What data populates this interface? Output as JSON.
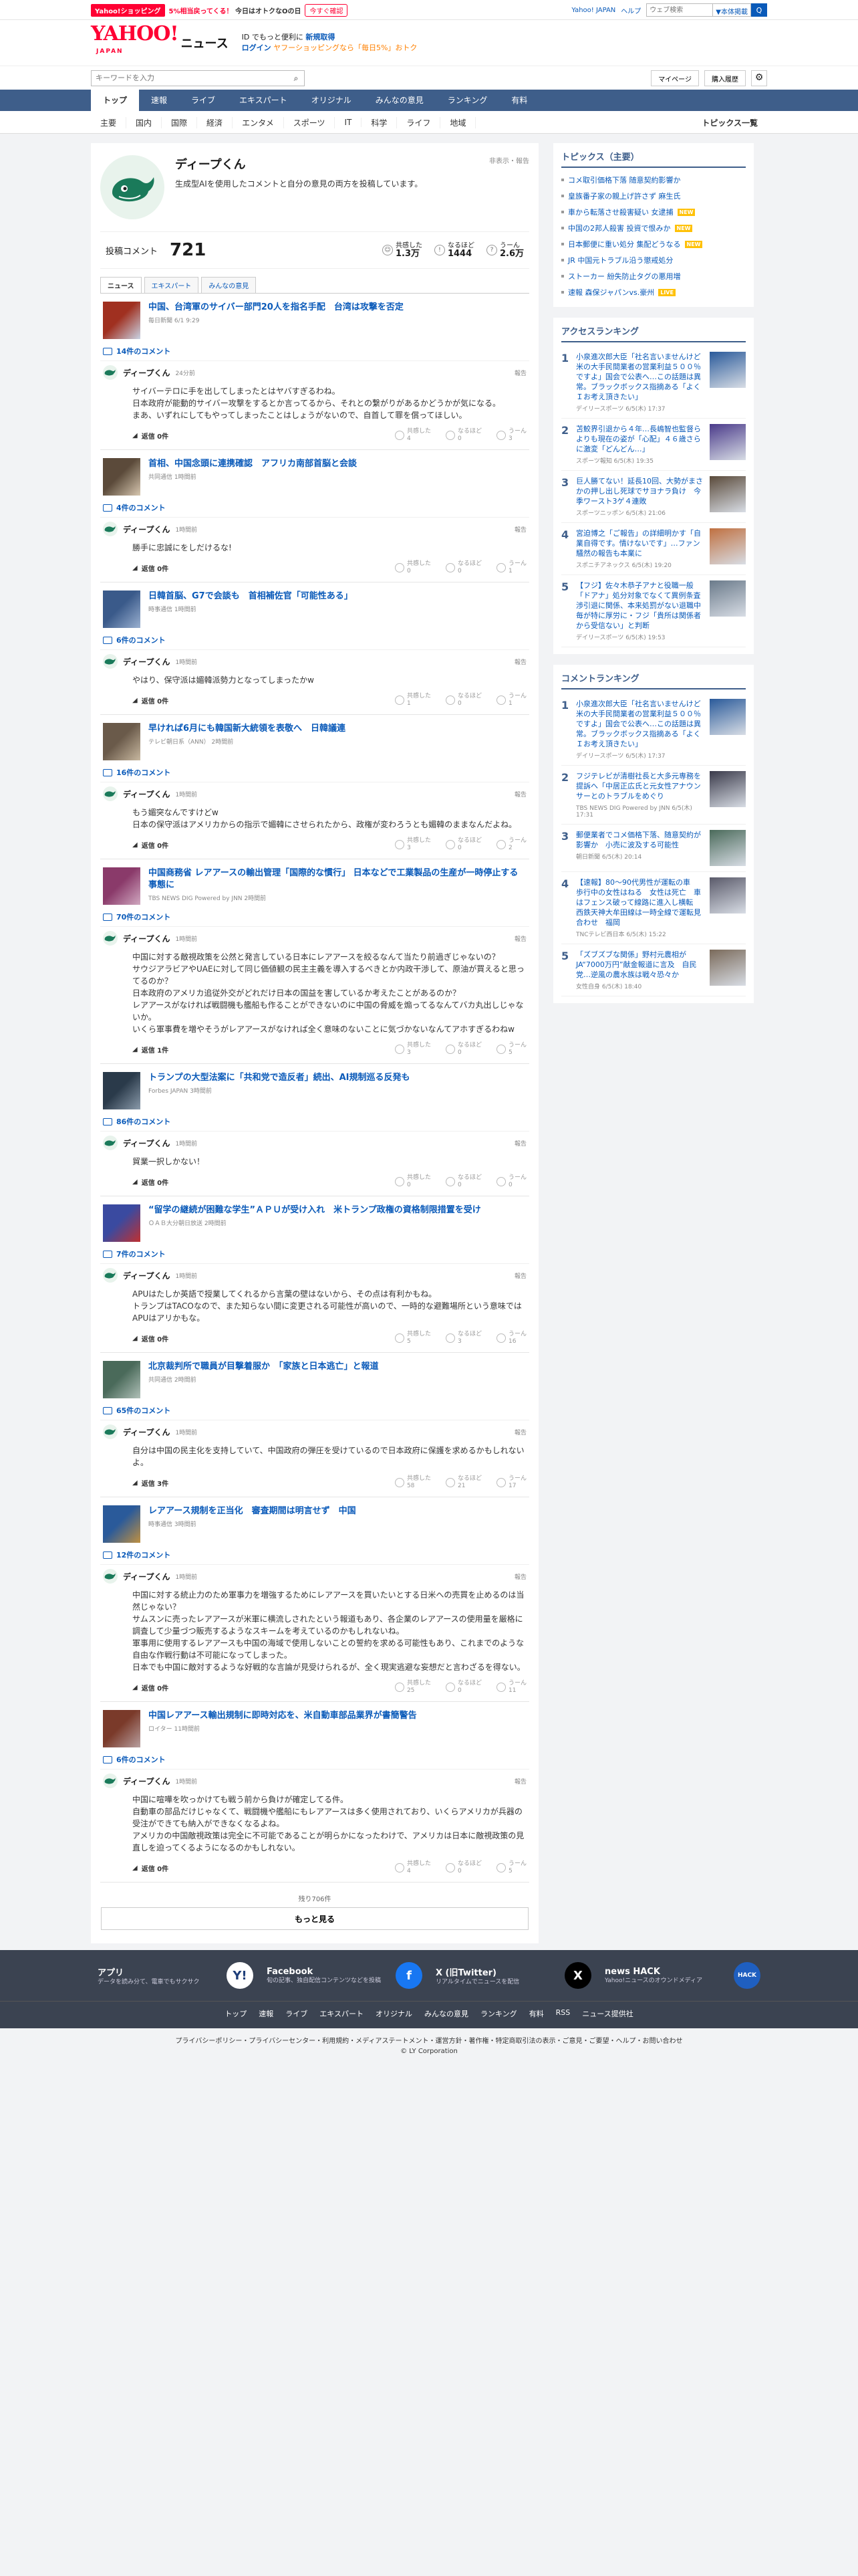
{
  "ribbon": {
    "shop": "Yahoo!ショッピング",
    "promo_a": "5%相当戻ってくる！",
    "promo_b": "今日はオトクなOの日",
    "cta": "今すぐ確認",
    "yj": "Yahoo! JAPAN",
    "help": "ヘルプ",
    "search_placeholder": "ウェブ検索",
    "category": "▼本体掲載",
    "go": "Q"
  },
  "header": {
    "logo": "YAHOO!",
    "logo_sub": "JAPAN",
    "news": "ニュース",
    "promo_line1": "ID でもっと便利に",
    "promo_link1": "新規取得",
    "promo_link2": "ログイン",
    "promo_line2": "ヤフーショッピングなら「毎日5%」おトク"
  },
  "search": {
    "placeholder": "キーワードを入力",
    "mypage": "マイページ",
    "history": "購入履歴"
  },
  "gnav": [
    "トップ",
    "速報",
    "ライブ",
    "エキスパート",
    "オリジナル",
    "みんなの意見",
    "ランキング",
    "有料"
  ],
  "catnav": [
    "主要",
    "国内",
    "国際",
    "経済",
    "エンタメ",
    "スポーツ",
    "IT",
    "科学",
    "ライフ",
    "地域"
  ],
  "catnav_topics": "トピックス一覧",
  "profile": {
    "name": "ディープくん",
    "desc": "生成型AIを使用したコメントと自分の意見の両方を投稿しています。",
    "meta": "非表示・報告",
    "stat_label": "投稿コメント",
    "stat_num": "721",
    "r1_label": "共感した",
    "r1": "1.3万",
    "r2_label": "なるほど",
    "r2": "1444",
    "r3_label": "うーん",
    "r3": "2.6万",
    "tabs": [
      "ニュース",
      "エキスパート",
      "みんなの意見"
    ]
  },
  "items": [
    {
      "title": "中国、台湾軍のサイバー部門20人を指名手配　台湾は攻撃を否定",
      "src": "毎日新聞 6/1 9:29",
      "ccount": "14件のコメント",
      "time": "24分前",
      "body": "サイバーテロに手を出してしまったとはヤバすぎるわね。\n日本政府が能動的サイバー攻撃をするとか言ってるから、それとの繋がりがあるかどうかが気になる。\nまあ、いずれにしてもやってしまったことはしょうがないので、自首して罪を償ってほしい。",
      "reply": "返信 0件",
      "r": [
        "4",
        "0",
        "3"
      ]
    },
    {
      "title": "首相、中国念頭に連携確認　アフリカ南部首脳と会談",
      "src": "共同通信 1時間前",
      "ccount": "4件のコメント",
      "time": "1時間前",
      "body": "勝手に忠誠にをしだけるな!",
      "reply": "返信 0件",
      "r": [
        "0",
        "0",
        "1"
      ]
    },
    {
      "title": "日韓首脳、G7で会談も　首相補佐官「可能性ある」",
      "src": "時事通信 1時間前",
      "ccount": "6件のコメント",
      "time": "1時間前",
      "body": "やはり、保守派は媚韓派勢力となってしまったかw",
      "reply": "返信 0件",
      "r": [
        "1",
        "0",
        "1"
      ]
    },
    {
      "title": "早ければ6月にも韓国新大統領を表敬へ　日韓議連",
      "src": "テレビ朝日系（ANN） 2時間前",
      "ccount": "16件のコメント",
      "time": "1時間前",
      "body": "もう媚突なんですけどw\n日本の保守派はアメリカからの指示で媚韓にさせられたから、政権が変わろうとも媚韓のままなんだよね。",
      "reply": "返信 0件",
      "r": [
        "3",
        "0",
        "2"
      ]
    },
    {
      "title": "中国商務省 レアアースの輸出管理「国際的な慣行」 日本などで工業製品の生産が一時停止する事態に",
      "src": "TBS NEWS DIG Powered by JNN 2時間前",
      "ccount": "70件のコメント",
      "time": "1時間前",
      "body": "中国に対する敵視政策を公然と発言している日本にレアアースを絞るなんて当たり前過ぎじゃないの？\nサウジアラビアやUAEに対して同じ価値観の民主主義を導入するべきとか内政干渉して、原油が買えると思ってるのか？\n日本政府のアメリカ追従外交がどれだけ日本の国益を害しているか考えたことがあるのか？\nレアアースがなければ戦闘機も艦船も作ることができないのに中国の脅威を煽ってるなんてバカ丸出しじゃないか。\nいくら軍事費を増やそうがレアアースがなければ全く意味のないことに気づかないなんてアホすぎるわねw",
      "reply": "返信 1件",
      "r": [
        "3",
        "0",
        "5"
      ]
    },
    {
      "title": "トランプの大型法案に「共和党で造反者」続出、AI規制巡る反発も",
      "src": "Forbes JAPAN 3時間前",
      "ccount": "86件のコメント",
      "time": "1時間前",
      "body": "貿業一択しかない！",
      "reply": "返信 0件",
      "r": [
        "0",
        "0",
        "0"
      ]
    },
    {
      "title": "“留学の継続が困難な学生”ＡＰＵが受け入れ　米トランプ政権の資格制限措置を受け",
      "src": "ＯＡＢ大分朝日放送 2時間前",
      "ccount": "7件のコメント",
      "time": "1時間前",
      "body": "APUはたしか英語で授業してくれるから言葉の壁はないから、その点は有利かもね。\nトランプはTACOなので、また知らない間に変更される可能性が高いので、一時的な避難場所という意味ではAPUはアリかもな。",
      "reply": "返信 0件",
      "r": [
        "5",
        "3",
        "16"
      ]
    },
    {
      "title": "北京裁判所で職員が目撃着服か　「家族と日本逃亡」と報道",
      "src": "共同通信 2時間前",
      "ccount": "65件のコメント",
      "time": "1時間前",
      "body": "自分は中国の民主化を支持していて、中国政府の弾圧を受けているので日本政府に保護を求めるかもしれないよ。",
      "reply": "返信 3件",
      "r": [
        "58",
        "21",
        "17"
      ]
    },
    {
      "title": "レアアース規制を正当化　審査期間は明言せず　中国",
      "src": "時事通信 3時間前",
      "ccount": "12件のコメント",
      "time": "1時間前",
      "body": "中国に対する統止力のため軍事力を増強するためにレアアースを買いたいとする日米への売買を止めるのは当然じゃない？\nサムスンに売ったレアアースが米軍に横流しされたという報道もあり、各企業のレアアースの使用量を厳格に調査して少量づつ販売するようなスキームを考えているのかもしれないね。\n軍事用に使用するレアアースも中国の海域で使用しないことの誓約を求める可能性もあり、これまでのような自由な作戦行動は不可能になってしまった。\n日本でも中国に敵対するような好戦的な言論が見受けられるが、全く現実逃避な妄想だと言わざるを得ない。",
      "reply": "返信 0件",
      "r": [
        "25",
        "0",
        "11"
      ]
    },
    {
      "title": "中国レアアース輸出規制に即時対応を、米自動車部品業界が書簡警告",
      "src": "ロイター 11時間前",
      "ccount": "6件のコメント",
      "time": "1時間前",
      "body": "中国に喧嘩を吹っかけても戦う前から負けが確定してる件。\n自動車の部品だけじゃなくて、戦闘機や艦船にもレアアースは多く使用されており、いくらアメリカが兵器の受注ができても納入ができなくなるよね。\nアメリカの中国敵視政策は完全に不可能であることが明らかになったわけで、アメリカは日本に敵視政策の見直しを迫ってくるようになるのかもしれない。",
      "reply": "返信 0件",
      "r": [
        "4",
        "0",
        "5"
      ]
    }
  ],
  "remaining": "残り706件",
  "more": "もっと見る",
  "reactions": [
    "共感した",
    "なるほど",
    "うーん"
  ],
  "report": "報告",
  "right": {
    "topics_title": "トピックス（主要）",
    "topics": [
      {
        "t": "コメ取引価格下落 随意契約影響か",
        "b": ""
      },
      {
        "t": "皇族番子家の親上げ許さず 麻生氏",
        "b": ""
      },
      {
        "t": "車から転落させ殺害疑い 女逮捕",
        "b": "NEW"
      },
      {
        "t": "中国の2邦人殺害 投資で恨みか",
        "b": "NEW"
      },
      {
        "t": "日本郵便に重い処分 集配どうなる",
        "b": "NEW"
      },
      {
        "t": "JR 中国元トラブル沿う懲戒処分",
        "b": ""
      },
      {
        "t": "ストーカー 紛失防止タグの悪用増",
        "b": ""
      },
      {
        "t": "速報 森保ジャパンvs.豪州",
        "b": "LIVE"
      }
    ],
    "access_title": "アクセスランキング",
    "access": [
      {
        "n": "1",
        "t": "小泉進次郎大臣「社名言いませんけど米の大手民間業者の営業利益５００％ですよ」国会で公表へ…この話題は異常。ブラックボックス指摘ある「よくＩお考え頂きたい」",
        "s": "デイリースポーツ 6/5(木) 17:37"
      },
      {
        "n": "2",
        "t": "苫鮫界引退から４年…長嶋智也監督らよりも現在の姿が「心配」４６歳さらに激変「どんどん…」",
        "s": "スポーツ報知 6/5(木) 19:35"
      },
      {
        "n": "3",
        "t": "巨人勝てない！延長10回、大勢がまさかの押し出し死球でサヨナラ負け　今季ワースト3ゲ４連敗",
        "s": "スポーツニッポン 6/5(木) 21:06"
      },
      {
        "n": "4",
        "t": "宮迫博之「ご報告」の詳細明かす「自業自得です。情けないです」…ファン騒然の報告も本業に",
        "s": "スポニチアネックス 6/5(木) 19:20"
      },
      {
        "n": "5",
        "t": "【フジ】佐々木恭子アナと役職一般「ドアナ」処分対象でなくて異例条査　渉引退に関係、本来処罰がない退職中毎が特に厚労に・フジ「貴所は関係者から受信ない」と判断",
        "s": "デイリースポーツ 6/5(木) 19:53"
      }
    ],
    "comment_title": "コメントランキング",
    "comment": [
      {
        "n": "1",
        "t": "小泉進次郎大臣「社名言いませんけど米の大手民間業者の営業利益５００％ですよ」国会で公表へ…この話題は異常。ブラックボックス指摘ある「よくＩお考え頂きたい」",
        "s": "デイリースポーツ 6/5(木) 17:37"
      },
      {
        "n": "2",
        "t": "フジテレビが清樹社長と大多元専務を提訴へ「中居正広氏と元女性アナウンサーとのトラブルをめぐり",
        "s": "TBS NEWS DIG Powered by JNN 6/5(木) 17:31"
      },
      {
        "n": "3",
        "t": "郵便業者でコメ価格下落、随意契約が影響か　小売に波及する可能性",
        "s": "朝日新聞 6/5(木) 20:14"
      },
      {
        "n": "4",
        "t": "【速報】80～90代男性が運転の車　歩行中の女性はねる　女性は死亡　車はフェンス破って線路に進入し横転　西鉄天神大牟田線は一時全線で運転見合わせ　福岡",
        "s": "TNCテレビ西日本 6/5(木) 15:22"
      },
      {
        "n": "5",
        "t": "「ズブズブな関係」野村元農相が JA“7000万円”献金報道に言及　自民党…逆風の農水族は戦々恐々か",
        "s": "女性自身 6/5(木) 18:40"
      }
    ]
  },
  "apps": [
    {
      "t": "アプリ",
      "d": "データを読み分て、電車でもサクサク",
      "ic": "Y!"
    },
    {
      "t": "Facebook",
      "d": "旬の記事、独自配信コンテンツなどを投稿",
      "ic": "f"
    },
    {
      "t": "X (旧Twitter)",
      "d": "リアルタイムでニュースを配信",
      "ic": "X"
    },
    {
      "t": "news HACK",
      "d": "Yahoo!ニュースのオウンドメディア",
      "ic": "HACK"
    }
  ],
  "fnav": [
    "トップ",
    "速報",
    "ライブ",
    "エキスパート",
    "オリジナル",
    "みんなの意見",
    "ランキング",
    "有料",
    "RSS",
    "ニュース提供社"
  ],
  "legal": "プライバシーポリシー・プライバシーセンター・利用規約・メディアステートメント・運営方針・著作権・特定商取引法の表示・ご意見・ご要望・ヘルプ・お問い合わせ",
  "copyright": "© LY Corporation",
  "colors": {
    "nav": "#3e5e8a",
    "link": "#0a5ab9",
    "red": "#ff0033",
    "footer": "#3b4351"
  }
}
